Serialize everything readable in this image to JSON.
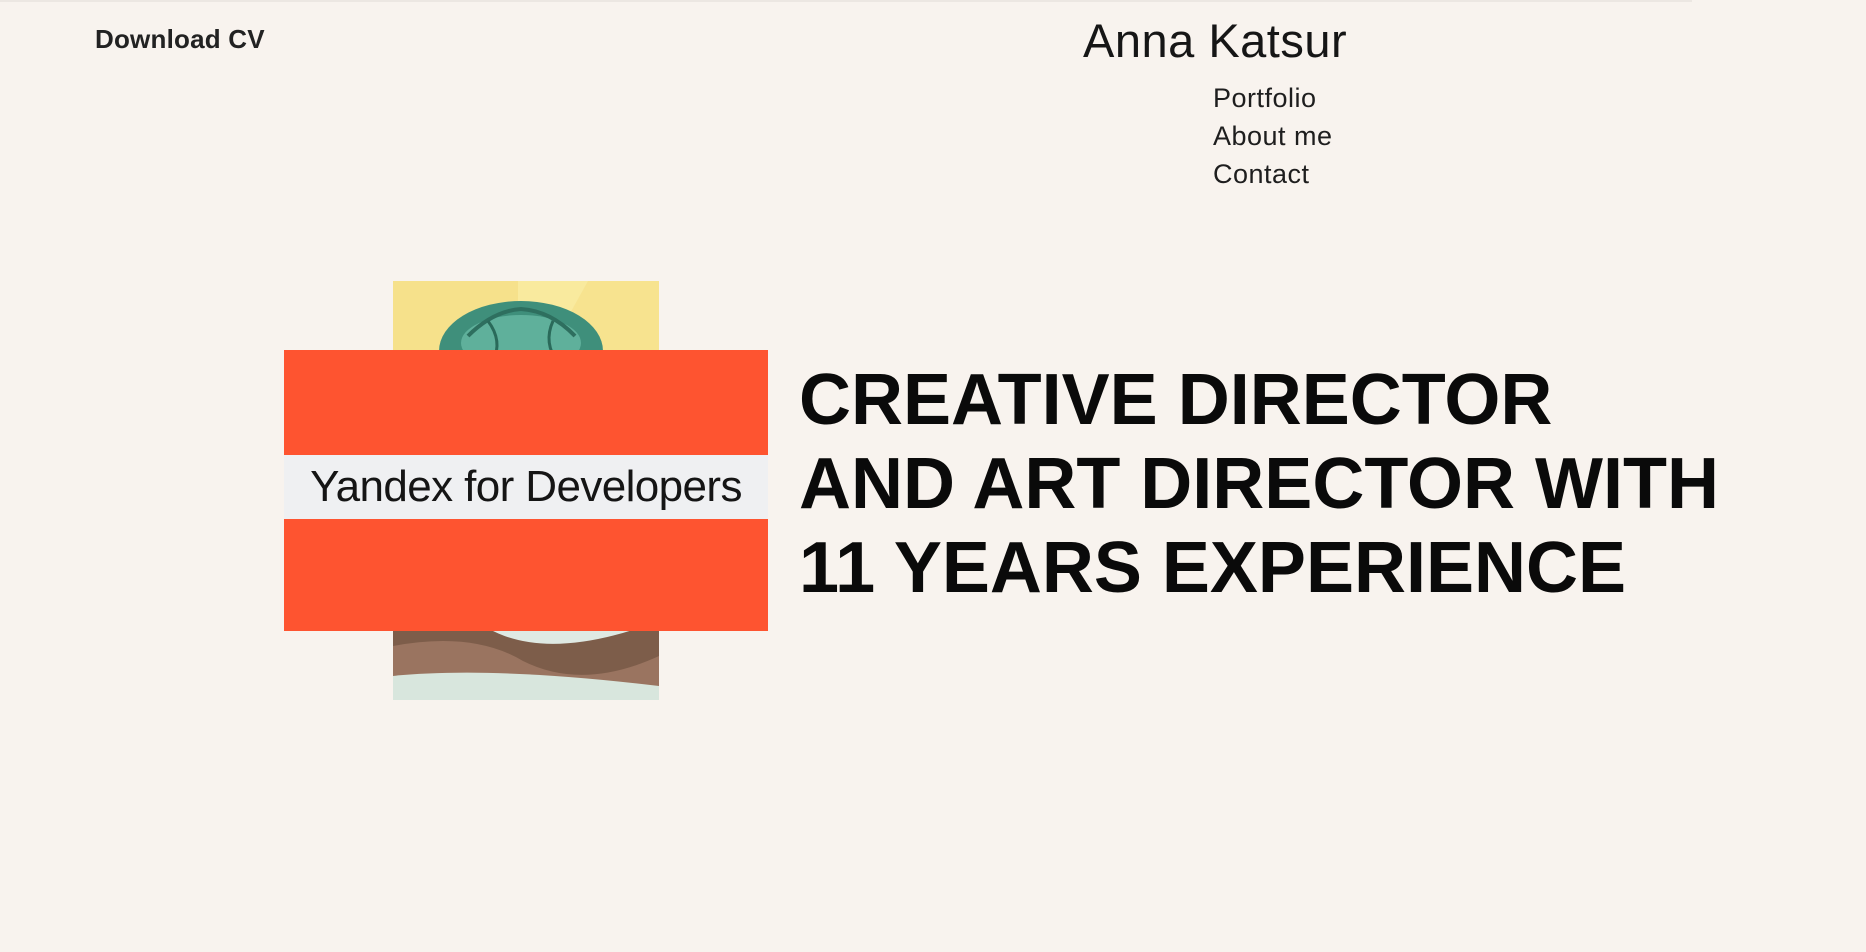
{
  "header": {
    "download_cv": "Download CV",
    "site_title": "Anna Katsur"
  },
  "nav": {
    "items": [
      {
        "label": "Portfolio"
      },
      {
        "label": "About me"
      },
      {
        "label": "Contact"
      }
    ]
  },
  "hero": {
    "banner_text": "Yandex for Developers",
    "banner_color": "#fe5430",
    "headline_lines": [
      "CREATIVE DIRECTOR",
      "AND ART DIRECTOR WITH",
      "11 YEARS EXPERIENCE"
    ]
  }
}
